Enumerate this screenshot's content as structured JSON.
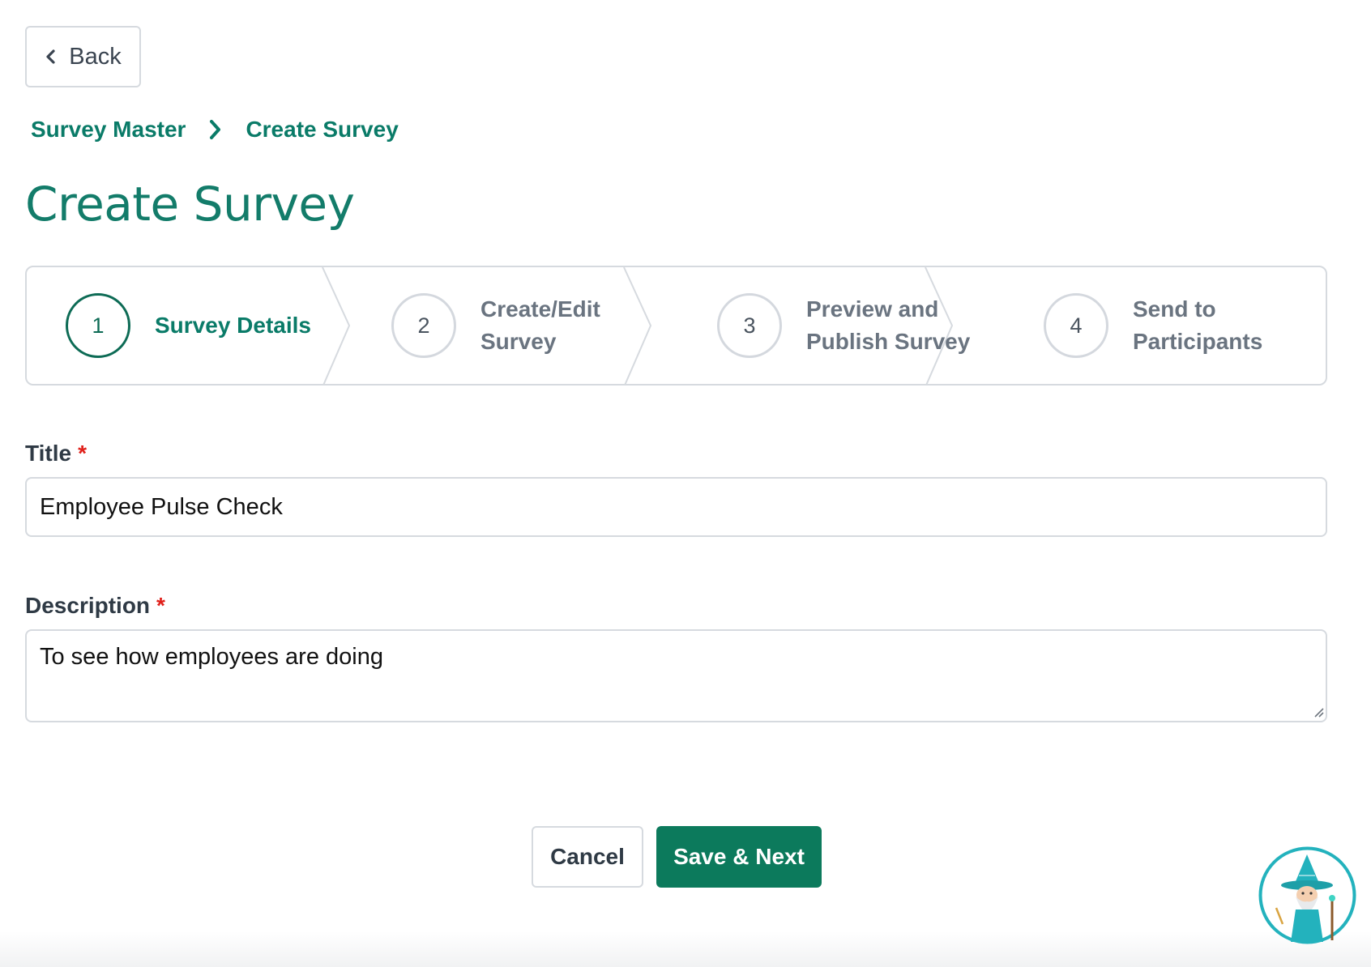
{
  "header": {
    "back_label": "Back"
  },
  "breadcrumb": {
    "items": [
      "Survey Master",
      "Create Survey"
    ]
  },
  "page_title": "Create Survey",
  "stepper": {
    "steps": [
      {
        "number": "1",
        "line1": "Survey Details",
        "line2": "",
        "state": "active"
      },
      {
        "number": "2",
        "line1": "Create/Edit",
        "line2": "Survey",
        "state": "inactive"
      },
      {
        "number": "3",
        "line1": "Preview and",
        "line2": "Publish Survey",
        "state": "inactive"
      },
      {
        "number": "4",
        "line1": "Send to",
        "line2": "Participants",
        "state": "inactive"
      }
    ]
  },
  "form": {
    "title_label": "Title",
    "title_value": "Employee Pulse Check",
    "description_label": "Description",
    "description_value": "To see how employees are doing",
    "required_marker": "*"
  },
  "actions": {
    "cancel_label": "Cancel",
    "save_label": "Save & Next"
  },
  "colors": {
    "brand": "#0a7b68",
    "primary_button": "#0c7a5c",
    "required": "#e0201a",
    "border": "#d6dadf"
  },
  "icons": {
    "back": "chevron-left-icon",
    "breadcrumb_separator": "chevron-right-icon",
    "help_assistant": "wizard-avatar-icon"
  }
}
